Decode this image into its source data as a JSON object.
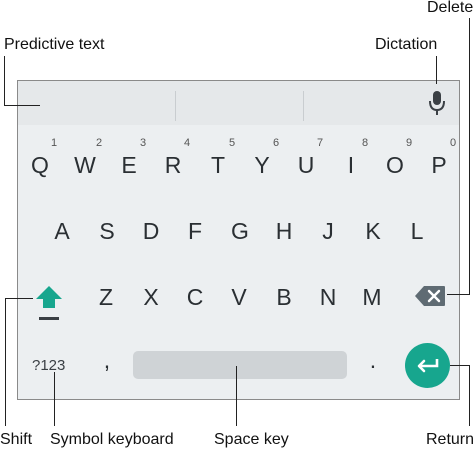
{
  "callouts": {
    "delete": "Delete",
    "predictive_text": "Predictive text",
    "dictation": "Dictation",
    "shift": "Shift",
    "symbol_keyboard": "Symbol keyboard",
    "space_key": "Space key",
    "return": "Return"
  },
  "keyboard": {
    "row1": [
      "Q",
      "W",
      "E",
      "R",
      "T",
      "Y",
      "U",
      "I",
      "O",
      "P"
    ],
    "row1_hints": [
      "1",
      "2",
      "3",
      "4",
      "5",
      "6",
      "7",
      "8",
      "9",
      "0"
    ],
    "row2": [
      "A",
      "S",
      "D",
      "F",
      "G",
      "H",
      "J",
      "K",
      "L"
    ],
    "row3": [
      "Z",
      "X",
      "C",
      "V",
      "B",
      "N",
      "M"
    ],
    "symbols_label": "?123",
    "comma": ",",
    "period": "."
  },
  "colors": {
    "accent": "#17a68e",
    "keyboard_bg": "#eceff1",
    "suggestion_bar": "#e5e8ea",
    "backspace_key": "#5f6b73"
  },
  "icons": {
    "mic": "microphone-icon",
    "backspace": "backspace-icon",
    "shift": "shift-arrow-icon",
    "return": "return-arrow-icon"
  }
}
